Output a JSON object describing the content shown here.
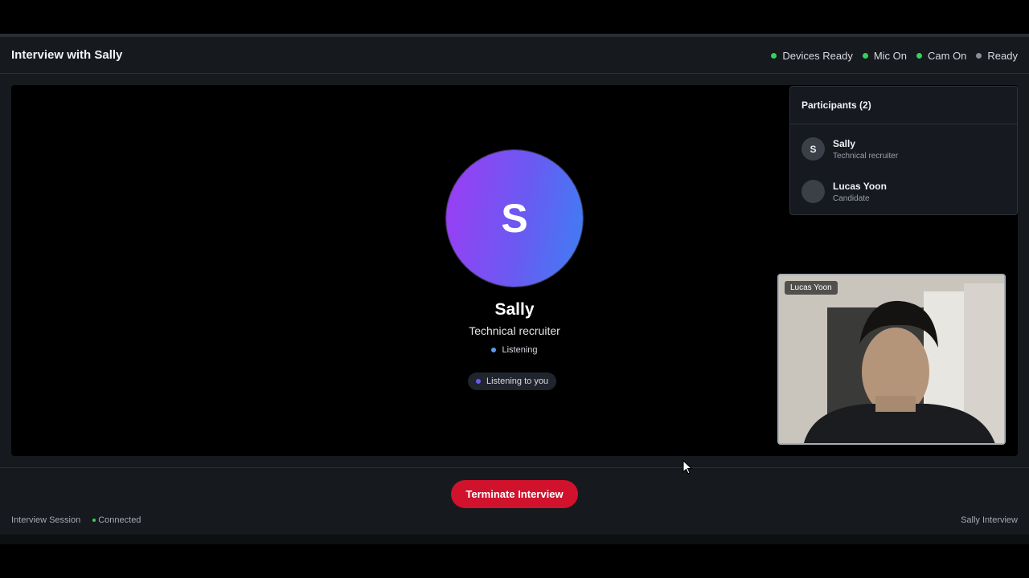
{
  "header": {
    "title": "Interview with Sally",
    "statuses": [
      {
        "label": "Devices Ready",
        "color": "#35d05a"
      },
      {
        "label": "Mic On",
        "color": "#35d05a"
      },
      {
        "label": "Cam On",
        "color": "#35d05a"
      },
      {
        "label": "Ready",
        "color": "#8a8f96"
      }
    ]
  },
  "agent": {
    "initial": "S",
    "name": "Sally",
    "role": "Technical recruiter",
    "state": "Listening",
    "state_color": "#5a9bf0",
    "pill": "Listening to you",
    "pill_dot_color": "#6a5af2"
  },
  "participants": {
    "heading": "Participants (2)",
    "items": [
      {
        "initial": "S",
        "name": "Sally",
        "role": "Technical recruiter"
      },
      {
        "initial": "",
        "name": "Lucas Yoon",
        "role": "Candidate"
      }
    ]
  },
  "selfview": {
    "label": "Lucas Yoon"
  },
  "controls": {
    "terminate_label": "Terminate Interview"
  },
  "footer": {
    "session": "Interview Session",
    "connection": "Connected",
    "connection_color": "#35d05a",
    "right": "Sally Interview"
  },
  "icons": {
    "avatar": "circle-letter",
    "cursor": "mouse-pointer-icon"
  },
  "colors": {
    "accent_red": "#d1122d",
    "gradient_start": "#9d3cf4",
    "gradient_end": "#3d7ff3"
  }
}
